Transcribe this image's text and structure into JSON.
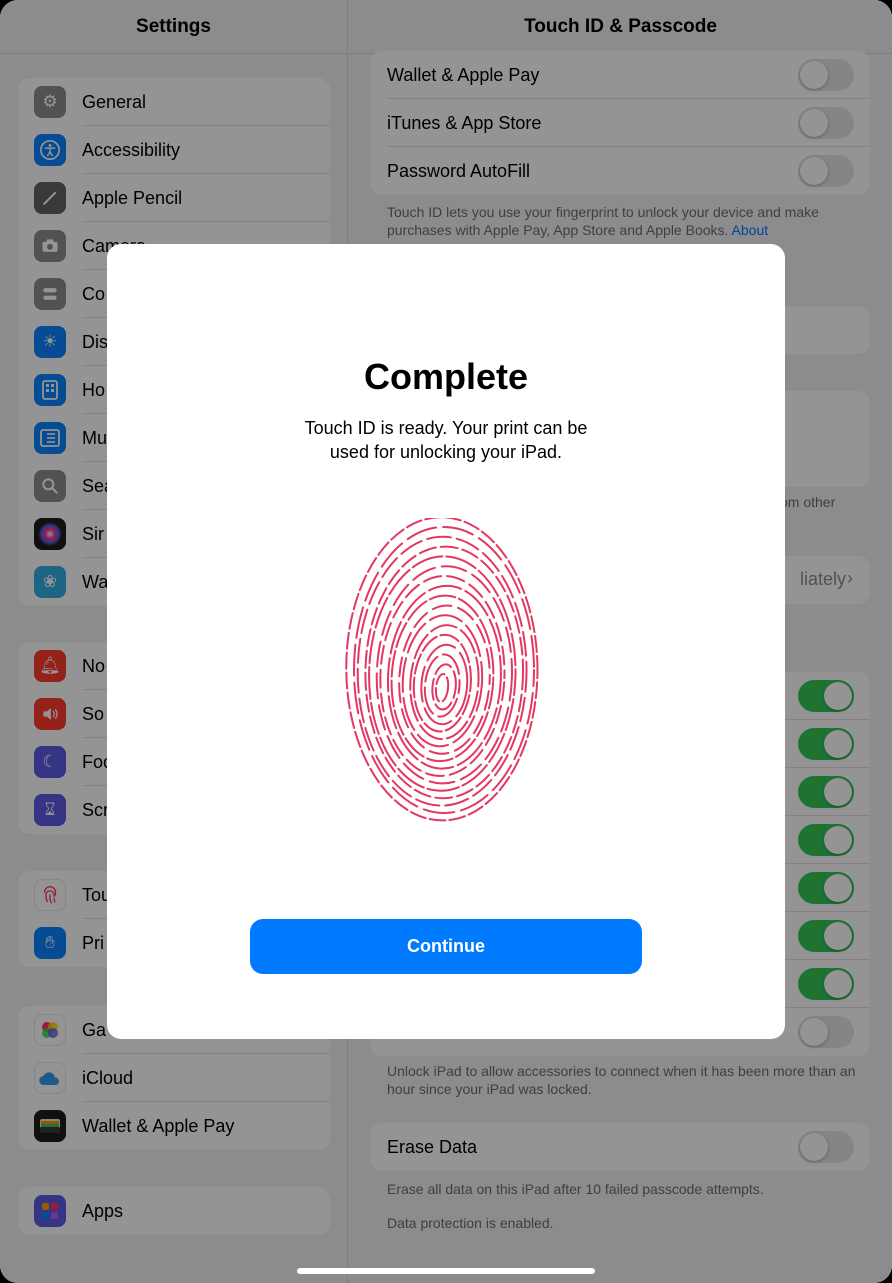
{
  "sidebar": {
    "title": "Settings",
    "group1": [
      {
        "label": "General",
        "icon": "gear-icon",
        "color": "#8e8e93"
      },
      {
        "label": "Accessibility",
        "icon": "accessibility-icon",
        "color": "#0a84ff"
      },
      {
        "label": "Apple Pencil",
        "icon": "pencil-icon",
        "color": "#636366"
      },
      {
        "label": "Camera",
        "icon": "camera-icon",
        "color": "#8e8e93"
      },
      {
        "label": "Co",
        "icon": "control-center-icon",
        "color": "#8e8e93"
      },
      {
        "label": "Dis",
        "icon": "display-icon",
        "color": "#0a84ff"
      },
      {
        "label": "Ho",
        "icon": "home-screen-icon",
        "color": "#0a84ff"
      },
      {
        "label": "Mu",
        "icon": "multitasking-icon",
        "color": "#0a84ff"
      },
      {
        "label": "Sea",
        "icon": "search-icon",
        "color": "#8e8e93"
      },
      {
        "label": "Sir",
        "icon": "siri-icon",
        "color": "#1c1c1e"
      },
      {
        "label": "Wa",
        "icon": "wallpaper-icon",
        "color": "#32ade6"
      }
    ],
    "group2": [
      {
        "label": "No",
        "icon": "notifications-icon",
        "color": "#ff3b30"
      },
      {
        "label": "So",
        "icon": "sounds-icon",
        "color": "#ff3b30"
      },
      {
        "label": "Foc",
        "icon": "focus-icon",
        "color": "#5e5ce6"
      },
      {
        "label": "Scr",
        "icon": "screen-time-icon",
        "color": "#5e5ce6"
      }
    ],
    "group3": [
      {
        "label": "Tou",
        "icon": "fingerprint-icon",
        "color": "#ffffff"
      },
      {
        "label": "Pri",
        "icon": "privacy-hand-icon",
        "color": "#0a84ff"
      }
    ],
    "group4": [
      {
        "label": "Ga",
        "icon": "game-center-icon",
        "color": "#ffffff"
      },
      {
        "label": "iCloud",
        "icon": "icloud-icon",
        "color": "#ffffff"
      },
      {
        "label": "Wallet & Apple Pay",
        "icon": "wallet-icon",
        "color": "#1c1c1e"
      }
    ],
    "group5": [
      {
        "label": "Apps",
        "icon": "apps-grid-icon",
        "color": "#5e5ce6"
      }
    ]
  },
  "detail": {
    "title": "Touch ID & Passcode",
    "use_rows": [
      {
        "label": "Wallet & Apple Pay"
      },
      {
        "label": "iTunes & App Store"
      },
      {
        "label": "Password AutoFill"
      }
    ],
    "touchid_note": "Touch ID lets you use your fingerprint to unlock your device and make purchases with Apple Pay, App Store and Apple Books.",
    "touchid_link": "About",
    "partial_other": "om other",
    "partial_immediately": "liately",
    "accessories_note": "Unlock iPad to allow accessories to connect when it has been more than an hour since your iPad was locked.",
    "erase_label": "Erase Data",
    "erase_note": "Erase all data on this iPad after 10 failed passcode attempts.",
    "protection_note": "Data protection is enabled."
  },
  "modal": {
    "title": "Complete",
    "text": "Touch ID is ready. Your print can be used for unlocking your iPad.",
    "continue_label": "Continue",
    "fingerprint_color": "#e3385f"
  },
  "colors": {
    "accent": "#007aff",
    "toggle_on": "#34c759"
  }
}
